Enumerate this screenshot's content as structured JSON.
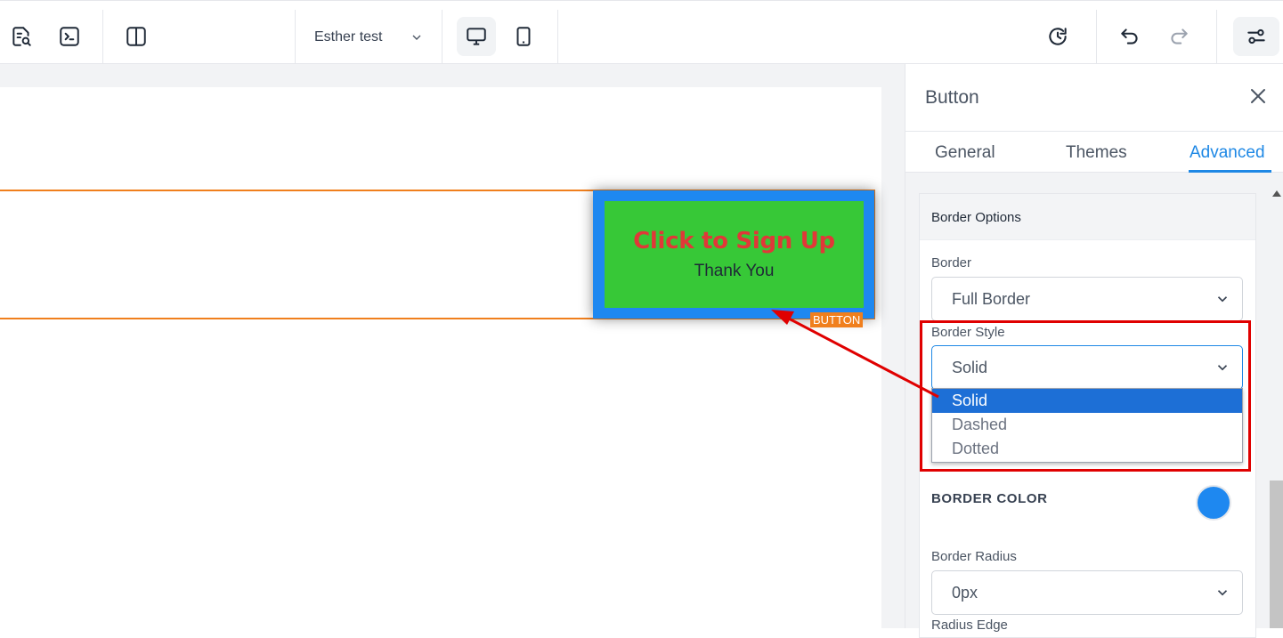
{
  "topbar": {
    "page_name": "Esther test",
    "icons": [
      "page-search-icon",
      "terminal-icon",
      "layout-split-icon",
      "desktop-icon",
      "mobile-icon",
      "history-icon",
      "undo-icon",
      "redo-icon",
      "settings-sliders-icon"
    ]
  },
  "canvas": {
    "button_title": "Click to Sign Up",
    "button_subtitle": "Thank You",
    "element_tag": "BUTTON",
    "colors": {
      "button_border": "#1e88f0",
      "button_bg": "#37c837",
      "button_text": "#e03838",
      "section_outline": "#f07f1d"
    }
  },
  "panel": {
    "title": "Button",
    "tabs": [
      {
        "label": "General",
        "active": false
      },
      {
        "label": "Themes",
        "active": false
      },
      {
        "label": "Advanced",
        "active": true
      }
    ],
    "section_title": "Border Options",
    "border": {
      "label": "Border",
      "value": "Full Border"
    },
    "border_style": {
      "label": "Border Style",
      "value": "Solid",
      "options": [
        "Solid",
        "Dashed",
        "Dotted"
      ],
      "selected": "Solid"
    },
    "border_color": {
      "label": "BORDER COLOR",
      "value": "#1e88f0"
    },
    "border_radius": {
      "label": "Border Radius",
      "value": "0px"
    },
    "radius_edge": {
      "label": "Radius Edge"
    }
  },
  "annotation": {
    "color": "#e00000"
  }
}
